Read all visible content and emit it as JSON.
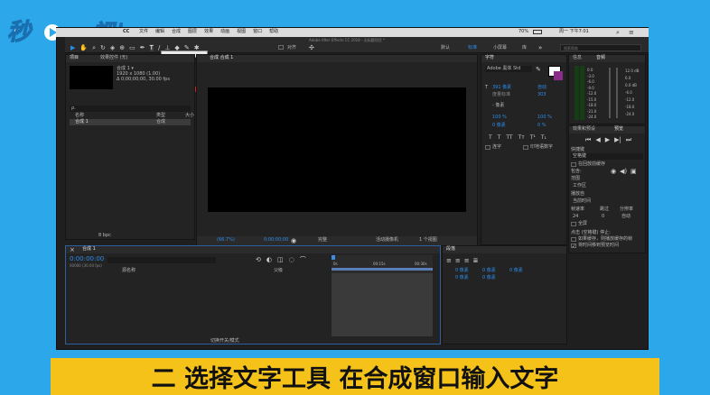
{
  "watermark": {
    "logo_text": "秒懂视频"
  },
  "caption": "二 选择文字工具 在合成窗口输入文字",
  "macbar": {
    "app": "CC",
    "menus": [
      "文件",
      "编辑",
      "合成",
      "图层",
      "效果",
      "动画",
      "视图",
      "窗口",
      "帮助"
    ],
    "battery": "70%",
    "clock": "周一 下午7:01"
  },
  "ae": {
    "window_title": "Adobe After Effects CC 2018 - 无标题项目 *",
    "tooltip": "横排文字工具 (Ctrl+T)",
    "align_label": "对齐",
    "workspaces": [
      "默认",
      "标准",
      "小屏幕",
      "库"
    ],
    "search_placeholder": "搜索帮助",
    "project": {
      "tabs": [
        "项目",
        "效果控件 (无)"
      ],
      "item_name": "合成 1 ▾",
      "item_info_1": "1920 x 1080 (1.00)",
      "item_info_2": "Δ 0;00;00;00, 30.00 fps",
      "search_icon_text": "ρ.",
      "col_name": "名称",
      "col_type": "类型",
      "col_size": "大小",
      "row_name": "合成 1",
      "row_type": "合成",
      "bpc": "8 bpc"
    },
    "composition": {
      "tab": "合成 合成 1",
      "zoom": "(66.7%)",
      "timecode": "0;00;00;00",
      "resolution": "完整",
      "camera": "活动摄像机",
      "views": "1 个视图"
    },
    "character": {
      "tab": "字符",
      "font": "Adobe 黑体 Std",
      "size": "391 像素",
      "leading": "自动",
      "kerning": "度量标准",
      "tracking": "303",
      "stroke": "- 像素",
      "vscale": "100 %",
      "hscale": "100 %",
      "baseline": "0 像素",
      "tsume": "0 %",
      "styles": [
        "T",
        "T",
        "TT",
        "Tт",
        "T¹",
        "T₁"
      ],
      "ligature": "连字",
      "hindi": "印地语数字"
    },
    "info": {
      "tabs": [
        "信息",
        "音频"
      ],
      "left_scale": [
        "0.0",
        "-3.0",
        "-6.0",
        "-9.0",
        "-12.0",
        "-15.0",
        "-18.0",
        "-21.0",
        "-24.0"
      ],
      "right_scale": [
        "12.0 dB",
        "6.0",
        "0.0 dB",
        "-6.0",
        "-12.0",
        "-18.0",
        "-24.0"
      ]
    },
    "preview": {
      "tabs": [
        "效果和预设",
        "预览"
      ],
      "shortcut_label": "快捷键",
      "shortcut_value": "空格键",
      "cache_label": "在回放前缓存",
      "include_label": "包含:",
      "range_label": "范围",
      "range_value": "工作区",
      "play_from_label": "播放自",
      "play_from_value": "当前时间",
      "fps_label": "帧速率",
      "skip_label": "跳过",
      "res_label": "分辨率",
      "fps_value": "24",
      "skip_value": "0",
      "res_value": "自动",
      "fullscreen_label": "全屏",
      "stop_label": "点击 (空格键) 停止:",
      "cache_option": "如果缓存，则播放缓存的帧",
      "move_option": "将时间移到预览时间"
    },
    "timeline": {
      "tab": "合成 1",
      "timecode": "0:00:00:00",
      "timecode_sub": "00000 (30.00 fps)",
      "col_source": "源名称",
      "col_mode": "父级",
      "ruler": [
        "0s",
        "00:15s",
        "00:30s"
      ],
      "toggle": "切换开关/模式"
    },
    "paragraph": {
      "tab": "段落",
      "fields": [
        "0 像素",
        "0 像素",
        "0 像素",
        "0 像素",
        "0 像素"
      ]
    }
  }
}
